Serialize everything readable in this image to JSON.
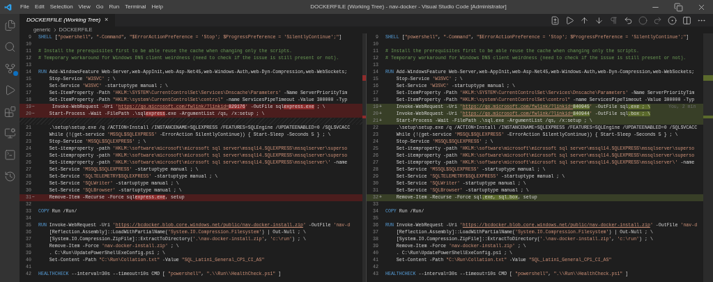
{
  "window": {
    "title": "DOCKERFILE (Working Tree) - nav-docker - Visual Studio Code [Administrator]",
    "menu": [
      "File",
      "Edit",
      "Selection",
      "View",
      "Go",
      "Run",
      "Terminal",
      "Help"
    ]
  },
  "tab": {
    "label": "DOCKERFILE (Working Tree)",
    "close": "×"
  },
  "breadcrumb": [
    "generic",
    "DOCKERFILE"
  ],
  "activity_badge": {
    "kind": "dot"
  },
  "panes": [
    {
      "lines": [
        {
          "kind": "context",
          "number": "9",
          "tokens": [
            {
              "kind": "keyword",
              "text": "SHELL"
            },
            {
              "kind": "text",
              "text": " ["
            },
            {
              "kind": "string",
              "text": "\"powershell\""
            },
            {
              "kind": "text",
              "text": ", "
            },
            {
              "kind": "string",
              "text": "\"-Command\""
            },
            {
              "kind": "text",
              "text": ", "
            },
            {
              "kind": "string",
              "text": "\"$ErrorActionPreference = 'Stop'; $ProgressPreference = 'SilentlyContinue';\""
            },
            {
              "kind": "text",
              "text": "]"
            }
          ]
        },
        {
          "kind": "context",
          "number": "10"
        },
        {
          "kind": "context",
          "number": "11",
          "tokens": [
            {
              "kind": "comment",
              "text": "# Install the prerequisites first to be able reuse the cache when changing only the scripts."
            }
          ]
        },
        {
          "kind": "context",
          "number": "12",
          "tokens": [
            {
              "kind": "comment",
              "text": "# Temporary workaround for Windows DNS client weirdness (need to check if the issue is still present or not)."
            }
          ]
        },
        {
          "kind": "context",
          "number": "13"
        },
        {
          "kind": "context",
          "number": "14",
          "tokens": [
            {
              "kind": "keyword",
              "text": "RUN"
            },
            {
              "kind": "text",
              "text": " Add-WindowsFeature Web-Server,web-AppInit,web-Asp-Net45,web-Windows-Auth,web-Dyn-Compression,web-WebSockets;"
            }
          ]
        },
        {
          "kind": "context",
          "number": "15",
          "tokens": [
            {
              "kind": "text",
              "text": "    Stop-Service "
            },
            {
              "kind": "string",
              "text": "'W3SVC'"
            },
            {
              "kind": "text",
              "text": " ; \\"
            }
          ]
        },
        {
          "kind": "context",
          "number": "16",
          "tokens": [
            {
              "kind": "text",
              "text": "    Set-Service "
            },
            {
              "kind": "string",
              "text": "'W3SVC'"
            },
            {
              "kind": "text",
              "text": " -startuptype manual ; \\"
            }
          ]
        },
        {
          "kind": "context",
          "number": "17",
          "tokens": [
            {
              "kind": "text",
              "text": "    Set-ItemProperty -Path "
            },
            {
              "kind": "string",
              "text": "'HKLM:\\SYSTEM\\CurrentControlSet\\Services\\Dnscache\\Parameters'"
            },
            {
              "kind": "text",
              "text": " -Name ServerPriorityTim"
            }
          ]
        },
        {
          "kind": "context",
          "number": "18",
          "tokens": [
            {
              "kind": "text",
              "text": "    Set-ItemProperty -Path "
            },
            {
              "kind": "string",
              "text": "\"HKLM:\\system\\CurrentControlSet\\control\""
            },
            {
              "kind": "text",
              "text": " -name ServicesPipeTimeout -Value 300000 -Typ"
            }
          ]
        },
        {
          "kind": "removed",
          "number": "19",
          "marker": "−",
          "tokens": [
            {
              "kind": "text",
              "text": "     Invoke-WebRequest -Uri "
            },
            {
              "kind": "string",
              "text": "'"
            },
            {
              "kind": "link",
              "text": "https://go.microsoft.com/fwlink/?linkid="
            },
            {
              "kind": "removed",
              "text": "829176"
            },
            {
              "kind": "string",
              "text": "'"
            },
            {
              "kind": "text",
              "text": " -OutFile sql"
            },
            {
              "kind": "removed",
              "text": "express.exe"
            },
            {
              "kind": "text",
              "text": " ; \\"
            }
          ]
        },
        {
          "kind": "removed",
          "number": "20",
          "marker": "−",
          "tokens": [
            {
              "kind": "text",
              "text": "    Start-Process -Wait -FilePath .\\sql"
            },
            {
              "kind": "removed",
              "text": "express"
            },
            {
              "kind": "text",
              "text": ".exe -ArgumentList /qs, /x:setup ; \\"
            }
          ]
        },
        {
          "kind": "filler"
        },
        {
          "kind": "context",
          "number": "21",
          "tokens": [
            {
              "kind": "text",
              "text": "    .\\setup\\setup.exe /q /ACTION=Install /INSTANCENAME=SQLEXPRESS /FEATURES=SQLEngine /UPDATEENABLED=0 /SQLSVCACC"
            }
          ]
        },
        {
          "kind": "context",
          "number": "22",
          "tokens": [
            {
              "kind": "text",
              "text": "    While (!(get-service "
            },
            {
              "kind": "string",
              "text": "'MSSQL$SQLEXPRESS'"
            },
            {
              "kind": "text",
              "text": " -ErrorAction SilentlyContinue)) { Start-Sleep -Seconds 5 } ; \\"
            }
          ]
        },
        {
          "kind": "context",
          "number": "23",
          "tokens": [
            {
              "kind": "text",
              "text": "    Stop-Service "
            },
            {
              "kind": "string",
              "text": "'MSSQL$SQLEXPRESS'"
            },
            {
              "kind": "text",
              "text": " ; \\"
            }
          ]
        },
        {
          "kind": "context",
          "number": "24",
          "tokens": [
            {
              "kind": "text",
              "text": "    Set-itemproperty -path "
            },
            {
              "kind": "string",
              "text": "'HKLM:\\software\\microsoft\\microsoft sql server\\mssql14.SQLEXPRESS\\mssqlserver\\superso"
            }
          ]
        },
        {
          "kind": "context",
          "number": "25",
          "tokens": [
            {
              "kind": "text",
              "text": "    Set-itemproperty -path "
            },
            {
              "kind": "string",
              "text": "'HKLM:\\software\\microsoft\\microsoft sql server\\mssql14.SQLEXPRESS\\mssqlserver\\superso"
            }
          ]
        },
        {
          "kind": "context",
          "number": "26",
          "tokens": [
            {
              "kind": "text",
              "text": "    Set-itemproperty -path "
            },
            {
              "kind": "string",
              "text": "'HKLM:\\software\\microsoft\\microsoft sql server\\mssql14.SQLEXPRESS\\mssqlserver\\'"
            },
            {
              "kind": "text",
              "text": " -name"
            }
          ]
        },
        {
          "kind": "context",
          "number": "27",
          "tokens": [
            {
              "kind": "text",
              "text": "    Set-Service "
            },
            {
              "kind": "string",
              "text": "'MSSQL$SQLEXPRESS'"
            },
            {
              "kind": "text",
              "text": " -startuptype manual ; \\"
            }
          ]
        },
        {
          "kind": "context",
          "number": "28",
          "tokens": [
            {
              "kind": "text",
              "text": "    Set-Service "
            },
            {
              "kind": "string",
              "text": "'SQLTELEMETRY$SQLEXPRESS'"
            },
            {
              "kind": "text",
              "text": " -startuptype manual ; \\"
            }
          ]
        },
        {
          "kind": "context",
          "number": "29",
          "tokens": [
            {
              "kind": "text",
              "text": "    Set-Service "
            },
            {
              "kind": "string",
              "text": "'SQLWriter'"
            },
            {
              "kind": "text",
              "text": " -startuptype manual ; \\"
            }
          ]
        },
        {
          "kind": "context",
          "number": "30",
          "tokens": [
            {
              "kind": "text",
              "text": "    Set-Service "
            },
            {
              "kind": "string",
              "text": "'SQLBrowser'"
            },
            {
              "kind": "text",
              "text": " -startuptype manual ; \\"
            }
          ]
        },
        {
          "kind": "removed",
          "number": "31",
          "marker": "−",
          "tokens": [
            {
              "kind": "text",
              "text": "    Remove-Item -Recurse -Force sql"
            },
            {
              "kind": "removed",
              "text": "express.exe"
            },
            {
              "kind": "text",
              "text": ", setup"
            }
          ]
        },
        {
          "kind": "context",
          "number": "32"
        },
        {
          "kind": "context",
          "number": "33",
          "tokens": [
            {
              "kind": "keyword",
              "text": "COPY"
            },
            {
              "kind": "text",
              "text": " Run /Run/"
            }
          ]
        },
        {
          "kind": "context",
          "number": "34"
        },
        {
          "kind": "context",
          "number": "35",
          "tokens": [
            {
              "kind": "keyword",
              "text": "RUN"
            },
            {
              "kind": "text",
              "text": " Invoke-WebRequest -Uri "
            },
            {
              "kind": "string",
              "text": "'"
            },
            {
              "kind": "link",
              "text": "https://bcdocker.blob.core.windows.net/public/nav-docker-install.zip"
            },
            {
              "kind": "string",
              "text": "'"
            },
            {
              "kind": "text",
              "text": " -OutFile "
            },
            {
              "kind": "string",
              "text": "'nav-d"
            }
          ]
        },
        {
          "kind": "context",
          "number": "36",
          "tokens": [
            {
              "kind": "text",
              "text": "    [Reflection.Assembly]::LoadWithPartialName("
            },
            {
              "kind": "string",
              "text": "'System.IO.Compression.Filesystem'"
            },
            {
              "kind": "text",
              "text": ") | Out-Null ; \\"
            }
          ]
        },
        {
          "kind": "context",
          "number": "37",
          "tokens": [
            {
              "kind": "text",
              "text": "    [System.IO.Compression.ZipFile]::ExtractToDirectory("
            },
            {
              "kind": "string",
              "text": "'.\\nav-docker-install.zip'"
            },
            {
              "kind": "text",
              "text": ", "
            },
            {
              "kind": "string",
              "text": "'c:\\run'"
            },
            {
              "kind": "text",
              "text": ") ; \\"
            }
          ]
        },
        {
          "kind": "context",
          "number": "38",
          "tokens": [
            {
              "kind": "text",
              "text": "    Remove-Item -Force "
            },
            {
              "kind": "string",
              "text": "'nav-docker-install.zip'"
            },
            {
              "kind": "text",
              "text": " ; \\"
            }
          ]
        },
        {
          "kind": "context",
          "number": "39",
          "tokens": [
            {
              "kind": "text",
              "text": "    . C:\\Run\\UpdatePowerShellExeConfig.ps1 ; \\"
            }
          ]
        },
        {
          "kind": "context",
          "number": "40",
          "tokens": [
            {
              "kind": "text",
              "text": "    Set-Content -Path "
            },
            {
              "kind": "string",
              "text": "\"C:\\Run\\Collation.txt\""
            },
            {
              "kind": "text",
              "text": " -Value "
            },
            {
              "kind": "string",
              "text": "\"SQL_Latin1_General_CP1_CI_AS\""
            }
          ]
        },
        {
          "kind": "context",
          "number": "41"
        },
        {
          "kind": "context",
          "number": "42",
          "tokens": [
            {
              "kind": "keyword",
              "text": "HEALTHCHECK"
            },
            {
              "kind": "text",
              "text": " --interval=30s --timeout=10s CMD [ "
            },
            {
              "kind": "string",
              "text": "\"powershell\""
            },
            {
              "kind": "text",
              "text": ", "
            },
            {
              "kind": "string",
              "text": "\".\\\\Run\\\\HealthCheck.ps1\""
            },
            {
              "kind": "text",
              "text": " ]"
            }
          ]
        }
      ]
    },
    {
      "lines": [
        {
          "kind": "context",
          "number": "9",
          "tokens": [
            {
              "kind": "keyword",
              "text": "SHELL"
            },
            {
              "kind": "text",
              "text": " ["
            },
            {
              "kind": "string",
              "text": "\"powershell\""
            },
            {
              "kind": "text",
              "text": ", "
            },
            {
              "kind": "string",
              "text": "\"-Command\""
            },
            {
              "kind": "text",
              "text": ", "
            },
            {
              "kind": "string",
              "text": "\"$ErrorActionPreference = 'Stop'; $ProgressPreference = 'SilentlyContinue';\""
            },
            {
              "kind": "text",
              "text": "]"
            }
          ]
        },
        {
          "kind": "context",
          "number": "10"
        },
        {
          "kind": "context",
          "number": "11",
          "tokens": [
            {
              "kind": "comment",
              "text": "# Install the prerequisites first to be able reuse the cache when changing only the scripts."
            }
          ]
        },
        {
          "kind": "context",
          "number": "12",
          "tokens": [
            {
              "kind": "comment",
              "text": "# Temporary workaround for Windows DNS client weirdness (need to check if the issue is still present or not)."
            }
          ]
        },
        {
          "kind": "context",
          "number": "13"
        },
        {
          "kind": "context",
          "number": "14",
          "tokens": [
            {
              "kind": "keyword",
              "text": "RUN"
            },
            {
              "kind": "text",
              "text": " Add-WindowsFeature Web-Server,web-AppInit,web-Asp-Net45,web-Windows-Auth,web-Dyn-Compression,web-WebSockets;"
            }
          ]
        },
        {
          "kind": "context",
          "number": "15",
          "tokens": [
            {
              "kind": "text",
              "text": "    Stop-Service "
            },
            {
              "kind": "string",
              "text": "'W3SVC'"
            },
            {
              "kind": "text",
              "text": " ; \\"
            }
          ]
        },
        {
          "kind": "context",
          "number": "16",
          "tokens": [
            {
              "kind": "text",
              "text": "    Set-Service "
            },
            {
              "kind": "string",
              "text": "'W3SVC'"
            },
            {
              "kind": "text",
              "text": " -startuptype manual ; \\"
            }
          ]
        },
        {
          "kind": "context",
          "number": "17",
          "tokens": [
            {
              "kind": "text",
              "text": "    Set-ItemProperty -Path "
            },
            {
              "kind": "string",
              "text": "'HKLM:\\SYSTEM\\CurrentControlSet\\Services\\Dnscache\\Parameters'"
            },
            {
              "kind": "text",
              "text": " -Name ServerPriorityTim"
            }
          ]
        },
        {
          "kind": "context",
          "number": "18",
          "tokens": [
            {
              "kind": "text",
              "text": "    Set-ItemProperty -Path "
            },
            {
              "kind": "string",
              "text": "\"HKLM:\\system\\CurrentControlSet\\control\""
            },
            {
              "kind": "text",
              "text": " -name ServicesPipeTimeout -Value 300000 -Typ"
            }
          ]
        },
        {
          "kind": "added",
          "number": "19",
          "marker": "+",
          "blame": "You, 2 min",
          "tokens": [
            {
              "kind": "text",
              "text": "    Invoke-WebRequest -Uri "
            },
            {
              "kind": "string",
              "text": "'"
            },
            {
              "kind": "link",
              "text": "https://go.microsoft.com/fwlink/?linkid="
            },
            {
              "kind": "added",
              "text": "840945"
            },
            {
              "kind": "string",
              "text": "'"
            },
            {
              "kind": "text",
              "text": " -OutFile sql"
            },
            {
              "kind": "added",
              "text": ".exe ; \\"
            }
          ]
        },
        {
          "kind": "added",
          "number": "20",
          "marker": "+",
          "tokens": [
            {
              "kind": "text",
              "text": "    Invoke-WebRequest -Uri "
            },
            {
              "kind": "string",
              "text": "'"
            },
            {
              "kind": "link",
              "text": "https://go.microsoft.com/fwlink/?linkid="
            },
            {
              "kind": "added",
              "text": "840944"
            },
            {
              "kind": "string",
              "text": "'"
            },
            {
              "kind": "text",
              "text": " -OutFile sql"
            },
            {
              "kind": "added",
              "text": ".box ; \\"
            }
          ]
        },
        {
          "kind": "added",
          "number": "21",
          "marker": "+",
          "tokens": [
            {
              "kind": "text",
              "text": "    Start-Process -Wait -FilePath .\\sql.exe -ArgumentList /qs, /x:setup ; \\"
            }
          ]
        },
        {
          "kind": "context",
          "number": "22",
          "tokens": [
            {
              "kind": "text",
              "text": "    .\\setup\\setup.exe /q /ACTION=Install /INSTANCENAME=SQLEXPRESS /FEATURES=SQLEngine /UPDATEENABLED=0 /SQLSVCACC"
            }
          ]
        },
        {
          "kind": "context",
          "number": "23",
          "tokens": [
            {
              "kind": "text",
              "text": "    While (!(get-service "
            },
            {
              "kind": "string",
              "text": "'MSSQL$SQLEXPRESS'"
            },
            {
              "kind": "text",
              "text": " -ErrorAction SilentlyContinue)) { Start-Sleep -Seconds 5 } ; \\"
            }
          ]
        },
        {
          "kind": "context",
          "number": "24",
          "tokens": [
            {
              "kind": "text",
              "text": "    Stop-Service "
            },
            {
              "kind": "string",
              "text": "'MSSQL$SQLEXPRESS'"
            },
            {
              "kind": "text",
              "text": " ; \\"
            }
          ]
        },
        {
          "kind": "context",
          "number": "25",
          "tokens": [
            {
              "kind": "text",
              "text": "    Set-itemproperty -path "
            },
            {
              "kind": "string",
              "text": "'HKLM:\\software\\microsoft\\microsoft sql server\\mssql14.SQLEXPRESS\\mssqlserver\\superso"
            }
          ]
        },
        {
          "kind": "context",
          "number": "26",
          "tokens": [
            {
              "kind": "text",
              "text": "    Set-itemproperty -path "
            },
            {
              "kind": "string",
              "text": "'HKLM:\\software\\microsoft\\microsoft sql server\\mssql14.SQLEXPRESS\\mssqlserver\\superso"
            }
          ]
        },
        {
          "kind": "context",
          "number": "27",
          "tokens": [
            {
              "kind": "text",
              "text": "    Set-itemproperty -path "
            },
            {
              "kind": "string",
              "text": "'HKLM:\\software\\microsoft\\microsoft sql server\\mssql14.SQLEXPRESS\\mssqlserver\\'"
            },
            {
              "kind": "text",
              "text": " -name"
            }
          ]
        },
        {
          "kind": "context",
          "number": "28",
          "tokens": [
            {
              "kind": "text",
              "text": "    Set-Service "
            },
            {
              "kind": "string",
              "text": "'MSSQL$SQLEXPRESS'"
            },
            {
              "kind": "text",
              "text": " -startuptype manual ; \\"
            }
          ]
        },
        {
          "kind": "context",
          "number": "29",
          "tokens": [
            {
              "kind": "text",
              "text": "    Set-Service "
            },
            {
              "kind": "string",
              "text": "'SQLTELEMETRY$SQLEXPRESS'"
            },
            {
              "kind": "text",
              "text": " -startuptype manual ; \\"
            }
          ]
        },
        {
          "kind": "context",
          "number": "30",
          "tokens": [
            {
              "kind": "text",
              "text": "    Set-Service "
            },
            {
              "kind": "string",
              "text": "'SQLWriter'"
            },
            {
              "kind": "text",
              "text": " -startuptype manual ; \\"
            }
          ]
        },
        {
          "kind": "context",
          "number": "31",
          "tokens": [
            {
              "kind": "text",
              "text": "    Set-Service "
            },
            {
              "kind": "string",
              "text": "'SQLBrowser'"
            },
            {
              "kind": "text",
              "text": " -startuptype manual ; \\"
            }
          ]
        },
        {
          "kind": "added",
          "number": "32",
          "marker": "+",
          "tokens": [
            {
              "kind": "text",
              "text": "    Remove-Item -Recurse -Force sql"
            },
            {
              "kind": "added",
              "text": ".exe, sql.box"
            },
            {
              "kind": "text",
              "text": ", setup"
            }
          ]
        },
        {
          "kind": "context",
          "number": "33"
        },
        {
          "kind": "context",
          "number": "34",
          "tokens": [
            {
              "kind": "keyword",
              "text": "COPY"
            },
            {
              "kind": "text",
              "text": " Run /Run/"
            }
          ]
        },
        {
          "kind": "context",
          "number": "35"
        },
        {
          "kind": "context",
          "number": "36",
          "tokens": [
            {
              "kind": "keyword",
              "text": "RUN"
            },
            {
              "kind": "text",
              "text": " Invoke-WebRequest -Uri "
            },
            {
              "kind": "string",
              "text": "'"
            },
            {
              "kind": "link",
              "text": "https://bcdocker.blob.core.windows.net/public/nav-docker-install.zip"
            },
            {
              "kind": "string",
              "text": "'"
            },
            {
              "kind": "text",
              "text": " -OutFile "
            },
            {
              "kind": "string",
              "text": "'nav-d"
            }
          ]
        },
        {
          "kind": "context",
          "number": "37",
          "tokens": [
            {
              "kind": "text",
              "text": "    [Reflection.Assembly]::LoadWithPartialName("
            },
            {
              "kind": "string",
              "text": "'System.IO.Compression.Filesystem'"
            },
            {
              "kind": "text",
              "text": ") | Out-Null ; \\"
            }
          ]
        },
        {
          "kind": "context",
          "number": "38",
          "tokens": [
            {
              "kind": "text",
              "text": "    [System.IO.Compression.ZipFile]::ExtractToDirectory("
            },
            {
              "kind": "string",
              "text": "'.\\nav-docker-install.zip'"
            },
            {
              "kind": "text",
              "text": ", "
            },
            {
              "kind": "string",
              "text": "'c:\\run'"
            },
            {
              "kind": "text",
              "text": ") ; \\"
            }
          ]
        },
        {
          "kind": "context",
          "number": "39",
          "tokens": [
            {
              "kind": "text",
              "text": "    Remove-Item -Force "
            },
            {
              "kind": "string",
              "text": "'nav-docker-install.zip'"
            },
            {
              "kind": "text",
              "text": " ; \\"
            }
          ]
        },
        {
          "kind": "context",
          "number": "40",
          "tokens": [
            {
              "kind": "text",
              "text": "    . C:\\Run\\UpdatePowerShellExeConfig.ps1 ; \\"
            }
          ]
        },
        {
          "kind": "context",
          "number": "41",
          "tokens": [
            {
              "kind": "text",
              "text": "    Set-Content -Path "
            },
            {
              "kind": "string",
              "text": "\"C:\\Run\\Collation.txt\""
            },
            {
              "kind": "text",
              "text": " -Value "
            },
            {
              "kind": "string",
              "text": "\"SQL_Latin1_General_CP1_CI_AS\""
            }
          ]
        },
        {
          "kind": "context",
          "number": "42"
        },
        {
          "kind": "context",
          "number": "43",
          "tokens": [
            {
              "kind": "keyword",
              "text": "HEALTHCHECK"
            },
            {
              "kind": "text",
              "text": " --interval=30s --timeout=10s CMD [ "
            },
            {
              "kind": "string",
              "text": "\"powershell\""
            },
            {
              "kind": "text",
              "text": ", "
            },
            {
              "kind": "string",
              "text": "\".\\\\Run\\\\HealthCheck.ps1\""
            },
            {
              "kind": "text",
              "text": " ]"
            }
          ]
        }
      ]
    }
  ]
}
